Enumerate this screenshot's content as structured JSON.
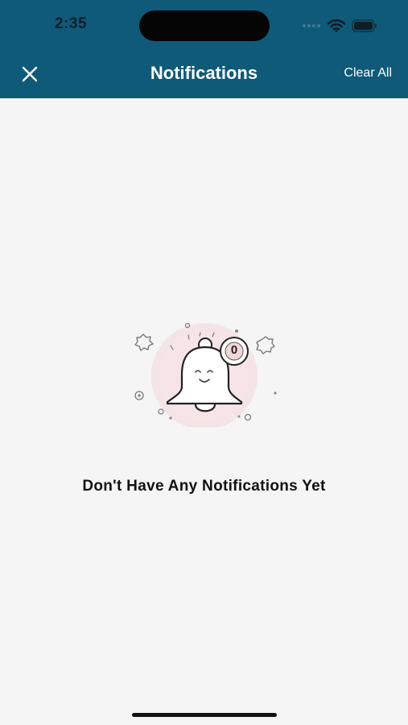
{
  "status_bar": {
    "time": "2:35"
  },
  "header": {
    "title": "Notifications",
    "clear_all_label": "Clear All",
    "close_icon": "close-icon",
    "background_color": "#0e5a78"
  },
  "empty_state": {
    "illustration_icon": "bell-icon",
    "badge_count": "0",
    "message": "Don't Have Any Notifications Yet"
  },
  "colors": {
    "background": "#f5f5f5",
    "accent_pink": "#f3d6d8"
  }
}
